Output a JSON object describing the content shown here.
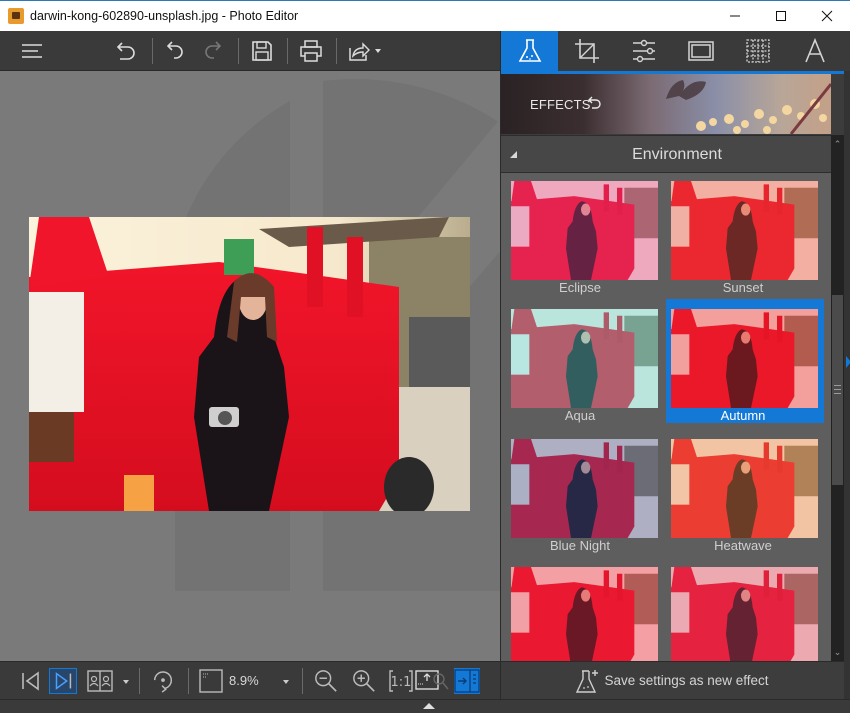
{
  "window": {
    "title": "darwin-kong-602890-unsplash.jpg - Photo Editor",
    "controls": {
      "minimize": "—",
      "maximize": "☐",
      "close": "✕"
    }
  },
  "top_toolbar": {
    "items": [
      {
        "name": "menu",
        "icon": "hamburger-menu-icon"
      },
      {
        "name": "undo-all",
        "icon": "undo-all-icon"
      },
      {
        "name": "undo",
        "icon": "undo-icon"
      },
      {
        "name": "redo",
        "icon": "redo-icon",
        "disabled": true
      },
      {
        "name": "save",
        "icon": "save-icon"
      },
      {
        "name": "print",
        "icon": "print-icon"
      },
      {
        "name": "share",
        "icon": "share-icon",
        "has_dropdown": true
      }
    ]
  },
  "tool_tabs": [
    {
      "name": "effects",
      "icon": "flask-icon",
      "active": true
    },
    {
      "name": "crop",
      "icon": "crop-icon",
      "active": false
    },
    {
      "name": "adjust",
      "icon": "sliders-icon",
      "active": false
    },
    {
      "name": "frames",
      "icon": "frame-icon",
      "active": false
    },
    {
      "name": "texture",
      "icon": "texture-icon",
      "active": false
    },
    {
      "name": "text",
      "icon": "text-icon",
      "active": false
    }
  ],
  "panel": {
    "banner_label": "EFFECTS",
    "category": "Environment",
    "effects": [
      {
        "label": "Eclipse",
        "selected": false,
        "tint": "#e23a8a"
      },
      {
        "label": "Sunset",
        "selected": false,
        "tint": "#f04a3a"
      },
      {
        "label": "Aqua",
        "selected": false,
        "tint": "#5ad8d8"
      },
      {
        "label": "Autumn",
        "selected": true,
        "tint": "#f0202a"
      },
      {
        "label": "Blue Night",
        "selected": false,
        "tint": "#3a4a90"
      },
      {
        "label": "Heatwave",
        "selected": false,
        "tint": "#f08040"
      },
      {
        "label": "",
        "selected": false,
        "tint": "#ee2040"
      },
      {
        "label": "",
        "selected": false,
        "tint": "#e03a60"
      }
    ],
    "save_effect_label": "Save settings as new effect"
  },
  "bottom_toolbar": {
    "zoom_level": "8.9%"
  },
  "colors": {
    "accent": "#1479d6",
    "toolbar_bg": "#3a3a3a",
    "canvas_bg": "#7a7a7a",
    "grid_bg": "#5e5e5e"
  }
}
